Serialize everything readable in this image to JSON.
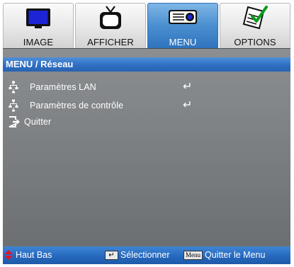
{
  "tabs": [
    {
      "label": "IMAGE",
      "icon": "monitor-icon",
      "active": false
    },
    {
      "label": "AFFICHER",
      "icon": "tv-icon",
      "active": false
    },
    {
      "label": "MENU",
      "icon": "projector-icon",
      "active": true
    },
    {
      "label": "OPTIONS",
      "icon": "notepad-check-icon",
      "active": false
    }
  ],
  "breadcrumb": "MENU / Réseau",
  "items": [
    {
      "label": "Paramètres LAN",
      "icon": "network-icon",
      "enter_icon": "enter-icon"
    },
    {
      "label": "Paramètres de contrôle",
      "icon": "network-icon",
      "enter_icon": "enter-icon"
    },
    {
      "label": "Quitter",
      "icon": "exit-icon"
    }
  ],
  "status_bar": {
    "nav_label": "Haut Bas",
    "select_label": "Sélectionner",
    "menu_key": "Menu",
    "quit_label": "Quitter le Menu"
  },
  "colors": {
    "active_tab": "#3f86d6",
    "breadcrumb_bar": "#2c6cc0",
    "panel_bg": "#7b7e81",
    "nav_arrow": "#e0142a"
  }
}
